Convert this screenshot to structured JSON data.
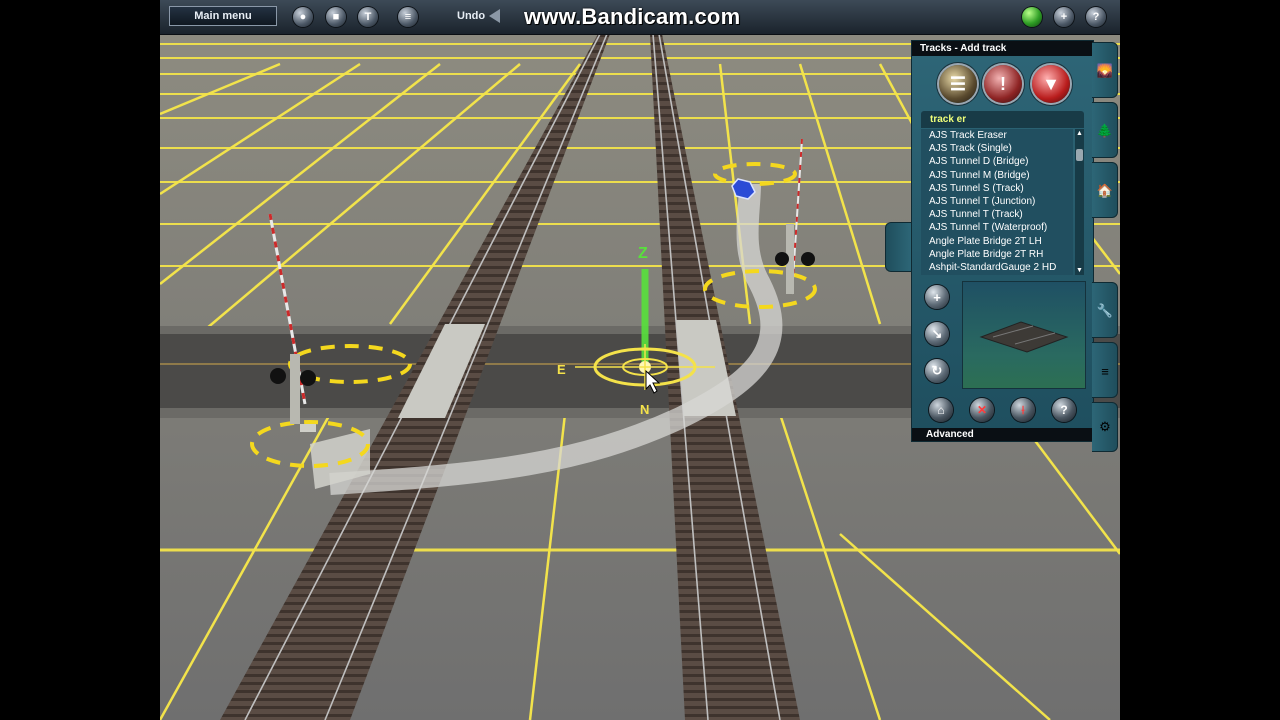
{
  "watermark": "www.Bandicam.com",
  "toolbar": {
    "main_menu": "Main menu",
    "undo": "Undo"
  },
  "panel": {
    "title": "Tracks - Add track",
    "filter": "track er",
    "items": [
      "AJS Track Eraser",
      "AJS Track (Single)",
      "AJS Tunnel D (Bridge)",
      "AJS Tunnel M (Bridge)",
      "AJS Tunnel S (Track)",
      "AJS Tunnel T (Junction)",
      "AJS Tunnel T (Track)",
      "AJS Tunnel T (Waterproof)",
      "Angle Plate Bridge 2T LH",
      "Angle Plate Bridge 2T RH",
      "Ashpit-StandardGauge 2 HD"
    ],
    "advanced": "Advanced"
  },
  "compass": {
    "z_label": "Z",
    "e_label": "E",
    "n_label": "N"
  },
  "colors": {
    "grid_line": "#f2e34b",
    "panel_bg": "#2a5f70",
    "toolbar_bg": "#1f2832"
  },
  "icons": [
    "globe-icon",
    "stop-icon",
    "tool-icon",
    "grid-icon",
    "undo-icon",
    "green-gem-icon",
    "plus-icon",
    "help-icon"
  ]
}
